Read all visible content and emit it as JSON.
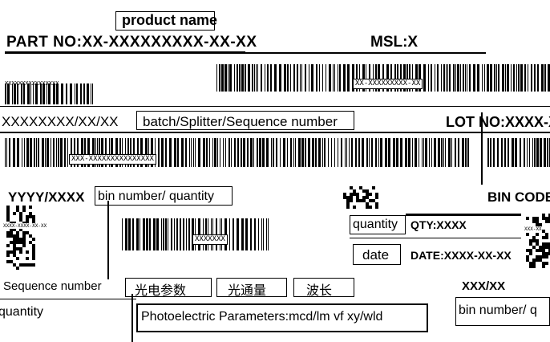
{
  "label": {
    "product_name": "product name",
    "part_no": "PART NO:XX-XXXXXXXXX-XX-XX",
    "msl": "MSL:X",
    "barcode_top_left_text": "XXXXXXXXXXXXXXXX",
    "barcode_top_right_text": "XX-XXXXXXXXX-XX",
    "batch_code": "XXXXXXXX/XX/XX",
    "batch_desc": "batch/Splitter/Sequence number",
    "lot_no": "LOT NO:XXXX-X",
    "barcode_middle_text": "XXX-XXXXXXXXXXXXXXX",
    "bin_code_left": "YYYY/XXXX",
    "bin_desc": "bin number/ quantity",
    "bin_code_right": "BIN CODE",
    "qr_left_text": "XXXX-XXXX-XX-XX",
    "qr_right_text": "XXX-XX",
    "barcode_inner_text": "XXXXXXX",
    "quantity_label": "quantity",
    "qty_value": "QTY:XXXX",
    "date_label": "date",
    "date_value": "DATE:XXXX-XX-XX",
    "sequence_label": "Sequence number",
    "btn1": "光电参数",
    "btn2": "光通量",
    "btn3": "波长",
    "ref_right": "XXX/XX",
    "quantity_bottom": "quantity",
    "photo_params": "Photoelectric Parameters:mcd/lm vf xy/wld",
    "bin_bottom_right": "bin number/ q"
  }
}
